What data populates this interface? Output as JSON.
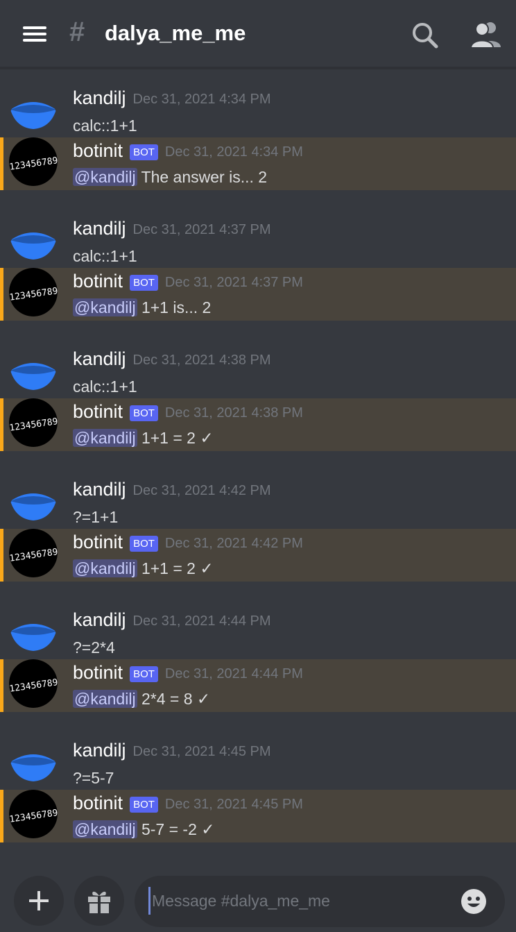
{
  "header": {
    "hash": "#",
    "channel_name": "dalya_me_me"
  },
  "messages": [
    {
      "author": "kandilj",
      "is_bot": false,
      "badge": "",
      "timestamp": "Dec 31, 2021 4:34 PM",
      "mention": "",
      "text": "calc::1+1"
    },
    {
      "author": "botinit",
      "is_bot": true,
      "badge": "BOT",
      "timestamp": "Dec 31, 2021 4:34 PM",
      "mention": "@kandilj",
      "text": " The answer is... 2"
    },
    {
      "author": "kandilj",
      "is_bot": false,
      "badge": "",
      "timestamp": "Dec 31, 2021 4:37 PM",
      "mention": "",
      "text": "calc::1+1"
    },
    {
      "author": "botinit",
      "is_bot": true,
      "badge": "BOT",
      "timestamp": "Dec 31, 2021 4:37 PM",
      "mention": "@kandilj",
      "text": " 1+1 is... 2"
    },
    {
      "author": "kandilj",
      "is_bot": false,
      "badge": "",
      "timestamp": "Dec 31, 2021 4:38 PM",
      "mention": "",
      "text": "calc::1+1"
    },
    {
      "author": "botinit",
      "is_bot": true,
      "badge": "BOT",
      "timestamp": "Dec 31, 2021 4:38 PM",
      "mention": "@kandilj",
      "text": " 1+1 = 2 ✓"
    },
    {
      "author": "kandilj",
      "is_bot": false,
      "badge": "",
      "timestamp": "Dec 31, 2021 4:42 PM",
      "mention": "",
      "text": "?=1+1"
    },
    {
      "author": "botinit",
      "is_bot": true,
      "badge": "BOT",
      "timestamp": "Dec 31, 2021 4:42 PM",
      "mention": "@kandilj",
      "text": " 1+1 = 2 ✓"
    },
    {
      "author": "kandilj",
      "is_bot": false,
      "badge": "",
      "timestamp": "Dec 31, 2021 4:44 PM",
      "mention": "",
      "text": "?=2*4"
    },
    {
      "author": "botinit",
      "is_bot": true,
      "badge": "BOT",
      "timestamp": "Dec 31, 2021 4:44 PM",
      "mention": "@kandilj",
      "text": " 2*4 = 8 ✓"
    },
    {
      "author": "kandilj",
      "is_bot": false,
      "badge": "",
      "timestamp": "Dec 31, 2021 4:45 PM",
      "mention": "",
      "text": "?=5-7"
    },
    {
      "author": "botinit",
      "is_bot": true,
      "badge": "BOT",
      "timestamp": "Dec 31, 2021 4:45 PM",
      "mention": "@kandilj",
      "text": " 5-7 = -2 ✓"
    }
  ],
  "avatars": {
    "bot_avatar_text": "123456789"
  },
  "composer": {
    "placeholder": "Message #dalya_me_me"
  },
  "icons": [
    "menu-icon",
    "search-icon",
    "members-icon",
    "plus-icon",
    "gift-icon",
    "emoji-icon"
  ],
  "colors": {
    "background": "#36393f",
    "bot_highlight": "#49443c",
    "bot_accent": "#faa81a",
    "badge": "#5865f2",
    "user_avatar": "#2f7cf6"
  }
}
